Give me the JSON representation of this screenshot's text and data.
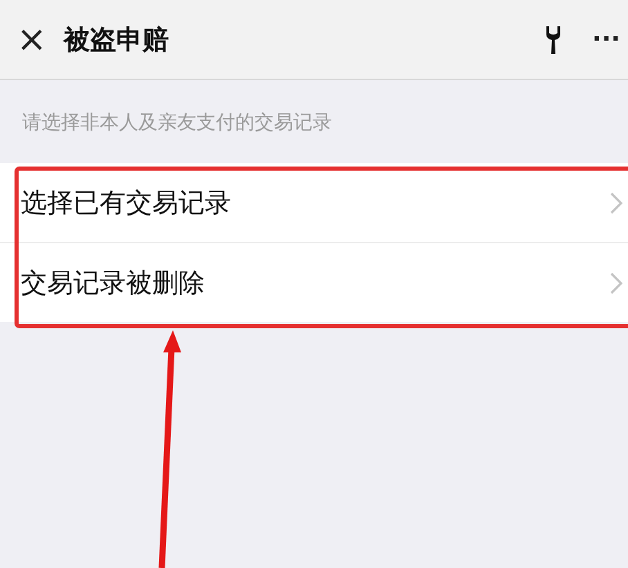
{
  "header": {
    "close": "×",
    "title": "被盗申赔",
    "more": "···"
  },
  "hint": "请选择非本人及亲友支付的交易记录",
  "options": [
    {
      "label": "选择已有交易记录"
    },
    {
      "label": "交易记录被删除"
    }
  ]
}
